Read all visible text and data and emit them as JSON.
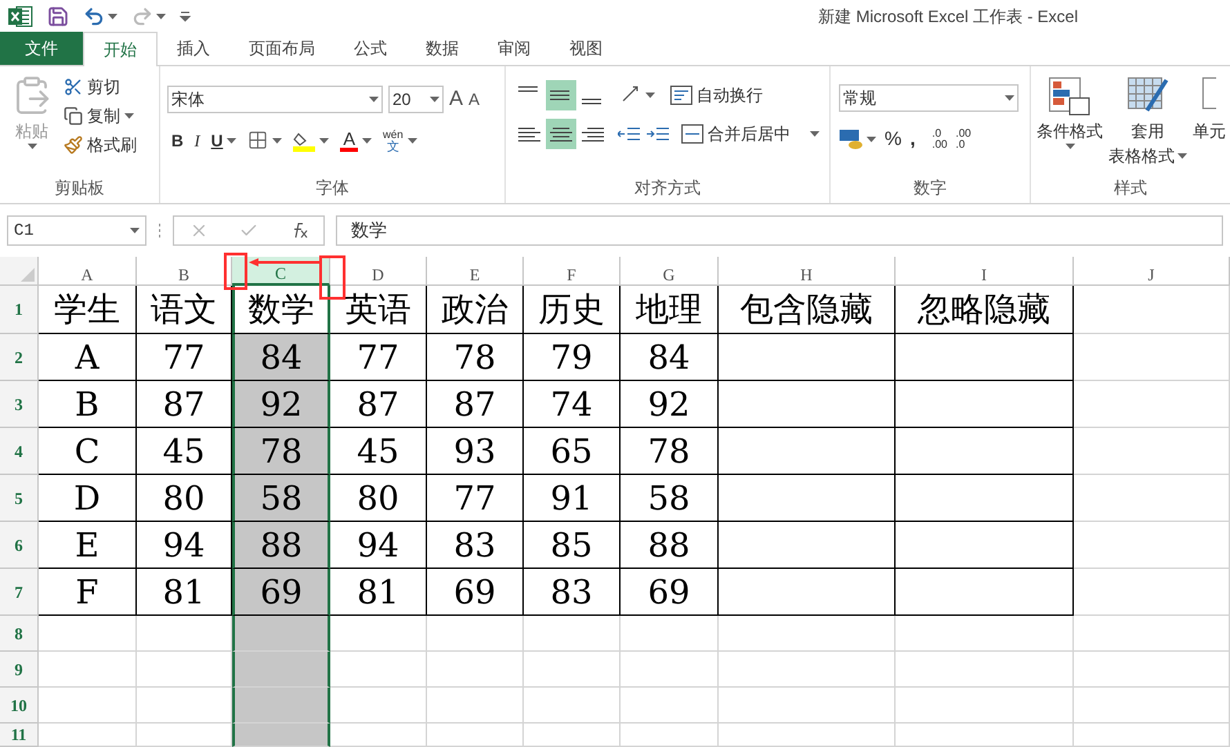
{
  "window": {
    "title": "新建 Microsoft Excel 工作表 - Excel"
  },
  "tabs": [
    {
      "label": "文件",
      "kind": "file",
      "selected": false
    },
    {
      "label": "开始",
      "kind": "tab",
      "selected": true
    },
    {
      "label": "插入",
      "kind": "tab",
      "selected": false
    },
    {
      "label": "页面布局",
      "kind": "tab",
      "selected": false
    },
    {
      "label": "公式",
      "kind": "tab",
      "selected": false
    },
    {
      "label": "数据",
      "kind": "tab",
      "selected": false
    },
    {
      "label": "审阅",
      "kind": "tab",
      "selected": false
    },
    {
      "label": "视图",
      "kind": "tab",
      "selected": false
    }
  ],
  "ribbon": {
    "clipboard": {
      "title": "剪贴板",
      "paste": "粘贴",
      "cut": "剪切",
      "copy": "复制",
      "format_painter": "格式刷"
    },
    "font": {
      "title": "字体",
      "font_name": "宋体",
      "font_size": "20",
      "grow": "A",
      "shrink": "A",
      "bold": "B",
      "italic": "I",
      "underline": "U",
      "font_color": "A",
      "phonetic_top": "wén",
      "phonetic_bottom": "文"
    },
    "alignment": {
      "title": "对齐方式",
      "vertical": [
        {
          "selected": false
        },
        {
          "selected": true
        },
        {
          "selected": false
        }
      ],
      "horizontal": [
        {
          "selected": false
        },
        {
          "selected": true
        },
        {
          "selected": false
        }
      ],
      "wrap_text": "自动换行",
      "merge_center": "合并后居中"
    },
    "number": {
      "title": "数字",
      "format": "常规",
      "percent": "%",
      "comma": ",",
      "increase_decimal": [
        ".0",
        ".00"
      ],
      "decrease_decimal": [
        ".00",
        ".0"
      ]
    },
    "styles": {
      "title": "样式",
      "conditional": "条件格式",
      "table_format_top": "套用",
      "table_format_bottom": "表格格式",
      "cell_styles": "单元"
    }
  },
  "name_box": "C1",
  "formula": "数学",
  "columns": [
    {
      "label": "A",
      "selected": false
    },
    {
      "label": "B",
      "selected": false
    },
    {
      "label": "C",
      "selected": true
    },
    {
      "label": "D",
      "selected": false
    },
    {
      "label": "E",
      "selected": false
    },
    {
      "label": "F",
      "selected": false
    },
    {
      "label": "G",
      "selected": false
    },
    {
      "label": "H",
      "selected": false
    },
    {
      "label": "I",
      "selected": false
    },
    {
      "label": "J",
      "selected": false
    }
  ],
  "rows": [
    {
      "header": "1",
      "cells": [
        "学生",
        "语文",
        "数学",
        "英语",
        "政治",
        "历史",
        "地理",
        "包含隐藏",
        "忽略隐藏"
      ]
    },
    {
      "header": "2",
      "cells": [
        "A",
        "77",
        "84",
        "77",
        "78",
        "79",
        "84"
      ]
    },
    {
      "header": "3",
      "cells": [
        "B",
        "87",
        "92",
        "87",
        "87",
        "74",
        "92"
      ]
    },
    {
      "header": "4",
      "cells": [
        "C",
        "45",
        "78",
        "45",
        "93",
        "65",
        "78"
      ]
    },
    {
      "header": "5",
      "cells": [
        "D",
        "80",
        "58",
        "80",
        "77",
        "91",
        "58"
      ]
    },
    {
      "header": "6",
      "cells": [
        "E",
        "94",
        "88",
        "94",
        "83",
        "85",
        "88"
      ]
    },
    {
      "header": "7",
      "cells": [
        "F",
        "81",
        "69",
        "81",
        "69",
        "83",
        "69"
      ]
    },
    {
      "header": "8"
    },
    {
      "header": "9"
    },
    {
      "header": "10"
    },
    {
      "header": "11"
    }
  ]
}
